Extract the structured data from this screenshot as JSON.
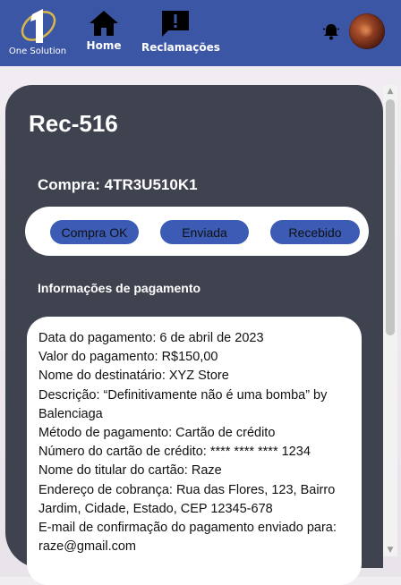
{
  "header": {
    "brand": "One Solution",
    "nav": [
      {
        "label": "Home",
        "icon": "home-icon"
      },
      {
        "label": "Reclamações",
        "icon": "complaint-icon"
      }
    ],
    "notification_icon": "bell-icon",
    "colors": {
      "bar": "#3c56a6",
      "accent": "#3b5bb5"
    }
  },
  "complaint": {
    "title": "Rec-516",
    "purchase_label": "Compra: 4TR3U510K1",
    "statuses": [
      "Compra OK",
      "Enviada",
      "Recebido"
    ],
    "payment_heading": "Informações de pagamento",
    "payment_lines": [
      "Data do pagamento: 6 de abril de 2023",
      "Valor do pagamento: R$150,00",
      "Nome do destinatário: XYZ Store",
      "Descrição: “Definitivamente não é uma bomba” by Balenciaga",
      "Método de pagamento: Cartão de crédito",
      "Número do cartão de crédito: **** **** **** 1234",
      "Nome do titular do cartão: Raze",
      "Endereço de cobrança: Rua das Flores, 123, Bairro Jardim, Cidade, Estado, CEP 12345-678",
      "E-mail de confirmação do pagamento enviado para: raze@gmail.com"
    ]
  }
}
